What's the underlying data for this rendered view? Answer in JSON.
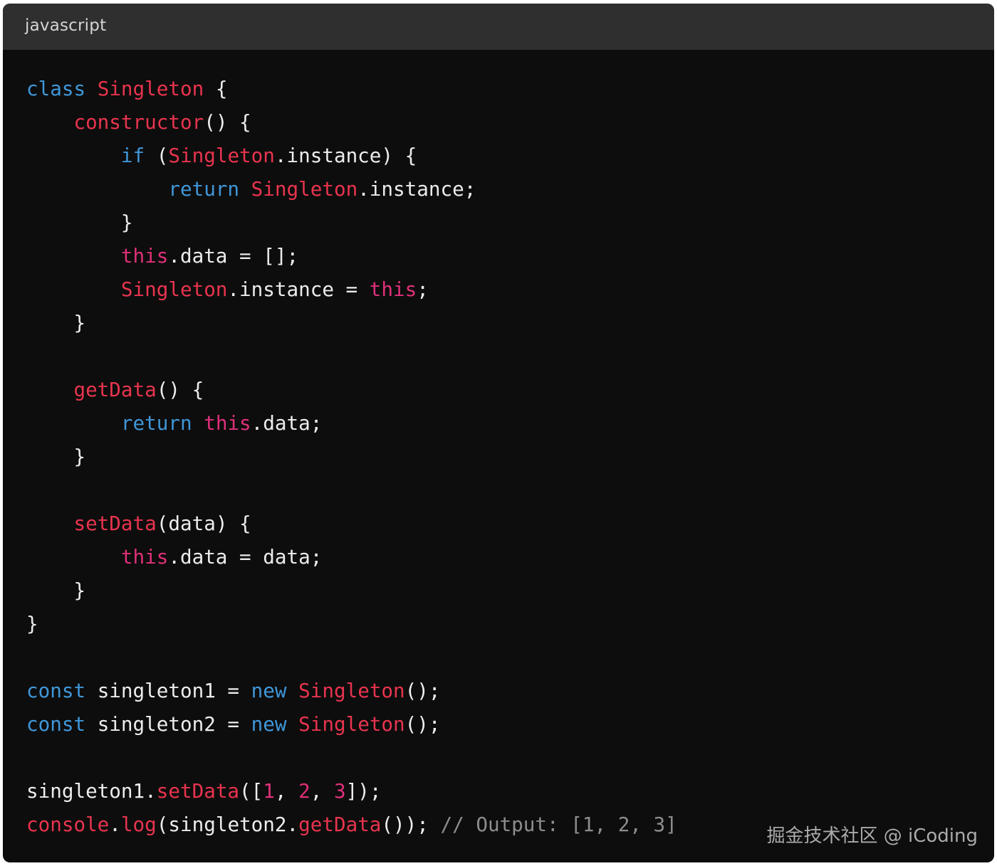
{
  "header": {
    "language": "javascript"
  },
  "colors": {
    "background": "#0d0d0d",
    "header_background": "#2f2f2f",
    "keyword": "#3f97d8",
    "class_or_function": "#e8344e",
    "this_or_number": "#df3079",
    "plain": "#ececec",
    "comment": "#8d8d8d"
  },
  "code": {
    "lines": [
      [
        {
          "t": "class",
          "k": "kw"
        },
        {
          "t": " ",
          "k": "plain"
        },
        {
          "t": "Singleton",
          "k": "cls"
        },
        {
          "t": " {",
          "k": "plain"
        }
      ],
      [
        {
          "t": "    ",
          "k": "plain"
        },
        {
          "t": "constructor",
          "k": "cls"
        },
        {
          "t": "() {",
          "k": "plain"
        }
      ],
      [
        {
          "t": "        ",
          "k": "plain"
        },
        {
          "t": "if",
          "k": "kw"
        },
        {
          "t": " (",
          "k": "plain"
        },
        {
          "t": "Singleton",
          "k": "cls"
        },
        {
          "t": ".instance) {",
          "k": "plain"
        }
      ],
      [
        {
          "t": "            ",
          "k": "plain"
        },
        {
          "t": "return",
          "k": "kw"
        },
        {
          "t": " ",
          "k": "plain"
        },
        {
          "t": "Singleton",
          "k": "cls"
        },
        {
          "t": ".instance;",
          "k": "plain"
        }
      ],
      [
        {
          "t": "        }",
          "k": "plain"
        }
      ],
      [
        {
          "t": "        ",
          "k": "plain"
        },
        {
          "t": "this",
          "k": "this"
        },
        {
          "t": ".data = [];",
          "k": "plain"
        }
      ],
      [
        {
          "t": "        ",
          "k": "plain"
        },
        {
          "t": "Singleton",
          "k": "cls"
        },
        {
          "t": ".instance = ",
          "k": "plain"
        },
        {
          "t": "this",
          "k": "this"
        },
        {
          "t": ";",
          "k": "plain"
        }
      ],
      [
        {
          "t": "    }",
          "k": "plain"
        }
      ],
      [],
      [
        {
          "t": "    ",
          "k": "plain"
        },
        {
          "t": "getData",
          "k": "cls"
        },
        {
          "t": "() {",
          "k": "plain"
        }
      ],
      [
        {
          "t": "        ",
          "k": "plain"
        },
        {
          "t": "return",
          "k": "kw"
        },
        {
          "t": " ",
          "k": "plain"
        },
        {
          "t": "this",
          "k": "this"
        },
        {
          "t": ".data;",
          "k": "plain"
        }
      ],
      [
        {
          "t": "    }",
          "k": "plain"
        }
      ],
      [],
      [
        {
          "t": "    ",
          "k": "plain"
        },
        {
          "t": "setData",
          "k": "cls"
        },
        {
          "t": "(data) {",
          "k": "plain"
        }
      ],
      [
        {
          "t": "        ",
          "k": "plain"
        },
        {
          "t": "this",
          "k": "this"
        },
        {
          "t": ".data = data;",
          "k": "plain"
        }
      ],
      [
        {
          "t": "    }",
          "k": "plain"
        }
      ],
      [
        {
          "t": "}",
          "k": "plain"
        }
      ],
      [],
      [
        {
          "t": "const",
          "k": "kw"
        },
        {
          "t": " singleton1 = ",
          "k": "plain"
        },
        {
          "t": "new",
          "k": "kw"
        },
        {
          "t": " ",
          "k": "plain"
        },
        {
          "t": "Singleton",
          "k": "cls"
        },
        {
          "t": "();",
          "k": "plain"
        }
      ],
      [
        {
          "t": "const",
          "k": "kw"
        },
        {
          "t": " singleton2 = ",
          "k": "plain"
        },
        {
          "t": "new",
          "k": "kw"
        },
        {
          "t": " ",
          "k": "plain"
        },
        {
          "t": "Singleton",
          "k": "cls"
        },
        {
          "t": "();",
          "k": "plain"
        }
      ],
      [],
      [
        {
          "t": "singleton1.",
          "k": "plain"
        },
        {
          "t": "setData",
          "k": "cls"
        },
        {
          "t": "([",
          "k": "plain"
        },
        {
          "t": "1",
          "k": "num"
        },
        {
          "t": ", ",
          "k": "plain"
        },
        {
          "t": "2",
          "k": "num"
        },
        {
          "t": ", ",
          "k": "plain"
        },
        {
          "t": "3",
          "k": "num"
        },
        {
          "t": "]);",
          "k": "plain"
        }
      ],
      [
        {
          "t": "console",
          "k": "cls"
        },
        {
          "t": ".",
          "k": "plain"
        },
        {
          "t": "log",
          "k": "cls"
        },
        {
          "t": "(singleton2.",
          "k": "plain"
        },
        {
          "t": "getData",
          "k": "cls"
        },
        {
          "t": "()); ",
          "k": "plain"
        },
        {
          "t": "// Output: [1, 2, 3]",
          "k": "com"
        }
      ]
    ]
  },
  "watermark": "掘金技术社区 @ iCoding"
}
